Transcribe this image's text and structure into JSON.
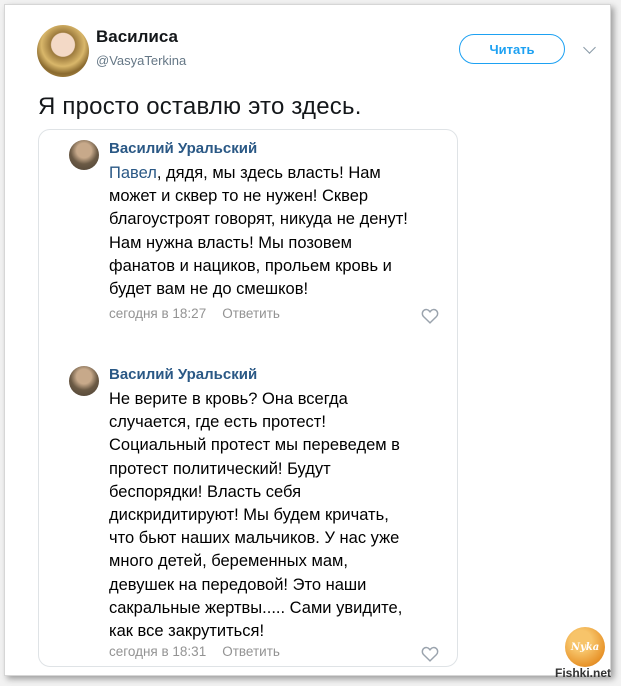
{
  "tweet": {
    "author_name": "Василиса",
    "author_handle": "@VasyaTerkina",
    "follow_label": "Читать",
    "text": "Я просто оставлю это здесь."
  },
  "comments": [
    {
      "author": "Василий Уральский",
      "mention": "Павел",
      "lines": [
        ", дядя, мы здесь власть! Нам",
        "может и сквер то не нужен! Сквер",
        "благоустроят говорят, никуда не денут!",
        "Нам нужна власть! Мы позовем",
        "фанатов и нациков, прольем кровь и",
        "будет вам не до смешков!"
      ],
      "time": "сегодня в 18:27",
      "reply_label": "Ответить"
    },
    {
      "author": "Василий Уральский",
      "lines": [
        "Не верите в кровь? Она всегда",
        "случается, где есть протест!",
        "Социальный протест мы переведем в",
        "протест политический! Будут",
        "беспорядки! Власть себя",
        "дискридитируют! Мы будем кричать,",
        "что бьют наших мальчиков. У нас уже",
        "много детей, беременных мам,",
        "девушек на передовой! Это наши",
        "сакральные жертвы..... Сами увидите,",
        "как все закрутиться!"
      ],
      "time": "сегодня в 18:31",
      "reply_label": "Ответить"
    }
  ],
  "watermark": {
    "logo_text": "Nyka",
    "site": "Fishki.net"
  },
  "icons": {
    "like": "heart-outline-icon",
    "menu": "chevron-down-icon"
  },
  "colors": {
    "twitter_blue": "#1da1f2",
    "vk_link": "#2a5885",
    "meta_gray": "#939393"
  }
}
